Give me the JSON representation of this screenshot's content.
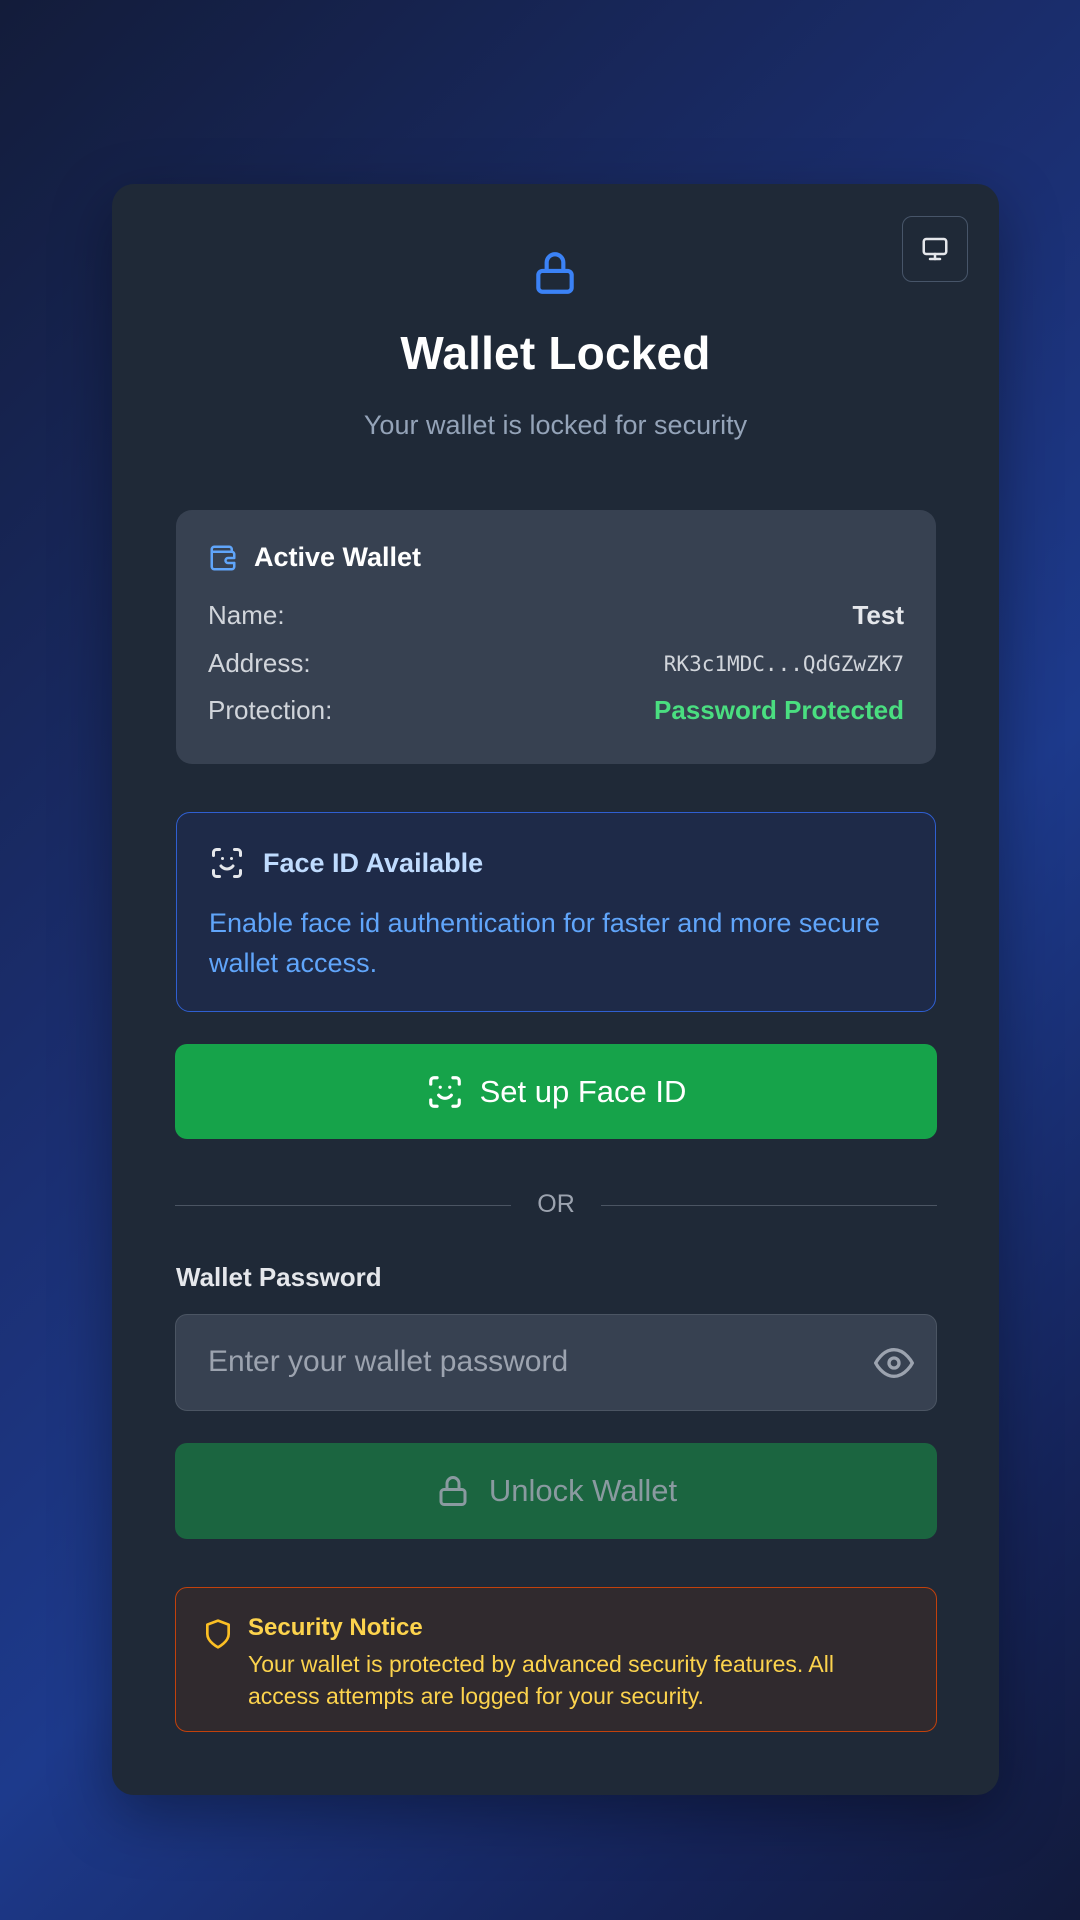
{
  "header": {
    "title": "Wallet Locked",
    "subtitle": "Your wallet is locked for security"
  },
  "wallet_info": {
    "heading": "Active Wallet",
    "rows": [
      {
        "label": "Name:",
        "value": "Test"
      },
      {
        "label": "Address:",
        "value": "RK3c1MDC...QdGZwZK7"
      },
      {
        "label": "Protection:",
        "value": "Password Protected"
      }
    ]
  },
  "face_id": {
    "heading": "Face ID Available",
    "description": "Enable face id authentication for faster and more secure wallet access.",
    "button_label": "Set up Face ID"
  },
  "divider": {
    "label": "OR"
  },
  "password": {
    "label": "Wallet Password",
    "value": "",
    "placeholder": "Enter your wallet password"
  },
  "unlock": {
    "button_label": "Unlock Wallet"
  },
  "notice": {
    "title": "Security Notice",
    "text": "Your wallet is protected by advanced security features. All access attempts are logged for your security."
  },
  "icons": {
    "top": "lock-icon",
    "screen": "monitor-icon",
    "wallet": "wallet-icon",
    "face": "face-id-icon",
    "eye": "eye-icon",
    "unlock": "lock-icon",
    "notice": "shield-icon"
  },
  "colors": {
    "accent_blue": "#3b82f6",
    "success_green": "#16a34a",
    "protected_green": "#4ade80",
    "notice_yellow": "#fcd34d",
    "notice_border": "#c2410c"
  }
}
